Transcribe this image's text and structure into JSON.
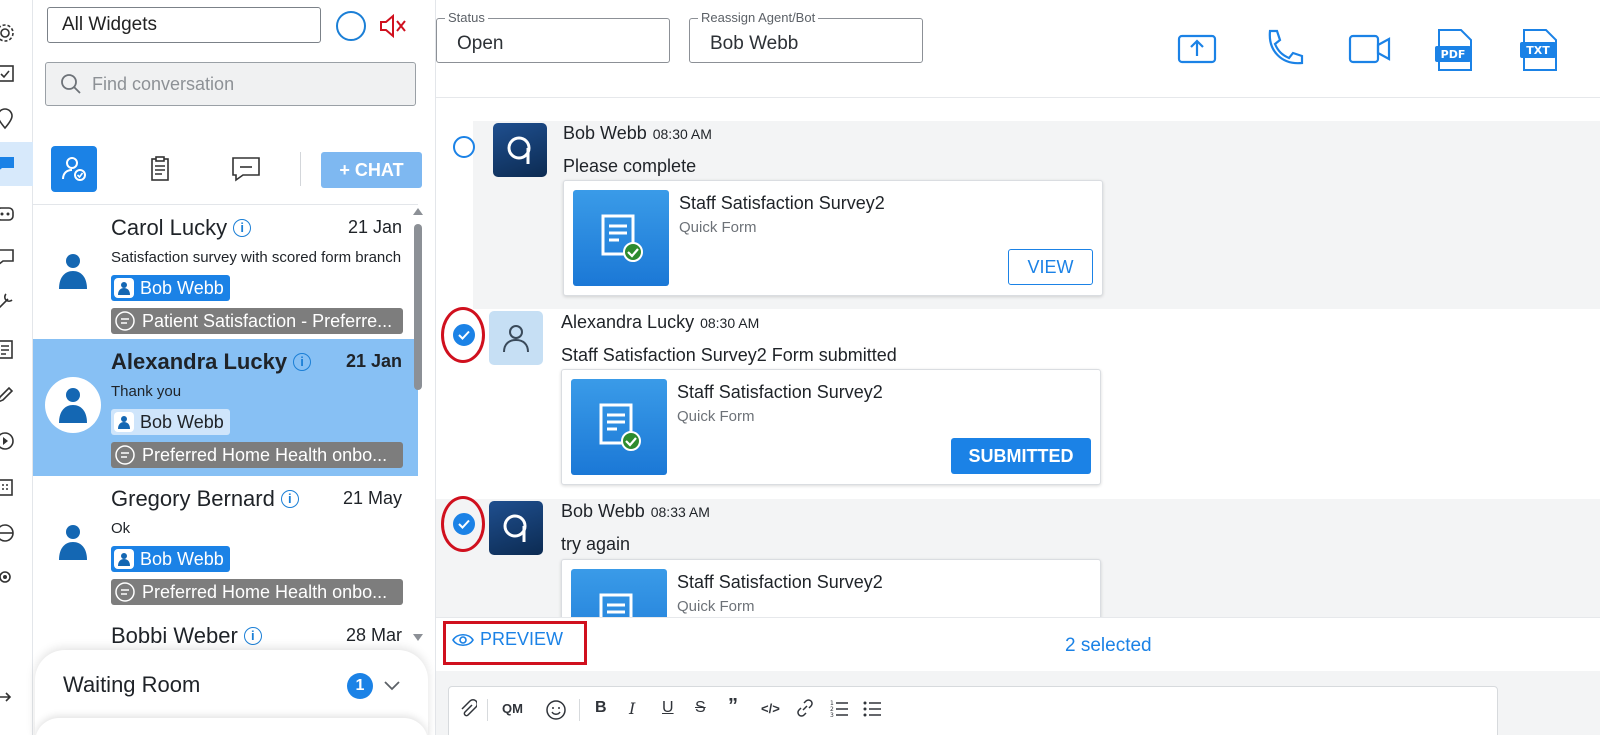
{
  "sidebar_rail": {
    "icons": [
      "settings-icon",
      "calendar-check-icon",
      "location-pin-icon",
      "chat-icon",
      "bot-icon",
      "comments-icon",
      "tools-icon",
      "forms-icon",
      "edit-icon",
      "play-circle-icon",
      "schedule-icon",
      "pie-chart-icon",
      "network-icon",
      "logout-icon"
    ],
    "active_index": 3
  },
  "conversations_panel": {
    "filter_value": "All Widgets",
    "search_placeholder": "Find conversation",
    "new_chat_label": "+ CHAT",
    "items": [
      {
        "name": "Carol Lucky",
        "date": "21 Jan",
        "preview": "Satisfaction survey with scored form branching",
        "agent": "Bob Webb",
        "form": "Patient Satisfaction - Preferre...",
        "selected": false
      },
      {
        "name": "Alexandra Lucky",
        "date": "21 Jan",
        "preview": "Thank you",
        "agent": "Bob Webb",
        "form": "Preferred Home Health onbo...",
        "selected": true
      },
      {
        "name": "Gregory Bernard",
        "date": "21 May",
        "preview": "Ok",
        "agent": "Bob Webb",
        "form": "Preferred Home Health onbo...",
        "selected": false
      },
      {
        "name": "Bobbi Weber",
        "date": "28 Mar",
        "preview": "",
        "agent": "",
        "form": "",
        "selected": false
      }
    ],
    "waiting_room": {
      "label": "Waiting Room",
      "count": "1"
    }
  },
  "header": {
    "status_legend": "Status",
    "status_value": "Open",
    "reassign_legend": "Reassign Agent/Bot",
    "reassign_value": "Bob Webb",
    "actions": [
      "upload-icon",
      "phone-icon",
      "video-icon",
      "pdf-export-icon",
      "txt-export-icon"
    ]
  },
  "messages": [
    {
      "sender": "Bob Webb",
      "time": "08:30 AM",
      "text": "Please complete",
      "card_title": "Staff Satisfaction Survey2",
      "card_subtitle": "Quick Form",
      "card_action": "VIEW",
      "checked": false
    },
    {
      "sender": "Alexandra Lucky",
      "time": "08:30 AM",
      "text": "Staff Satisfaction Survey2 Form submitted",
      "card_title": "Staff Satisfaction Survey2",
      "card_subtitle": "Quick Form",
      "card_action": "SUBMITTED",
      "checked": true
    },
    {
      "sender": "Bob Webb",
      "time": "08:33 AM",
      "text": "try again",
      "card_title": "Staff Satisfaction Survey2",
      "card_subtitle": "Quick Form",
      "card_action": "",
      "checked": true
    }
  ],
  "selection_bar": {
    "preview_label": "PREVIEW",
    "selected_count": "2 selected"
  },
  "composer_toolbar": {
    "qm_label": "QM",
    "tools": [
      "attach-icon",
      "quick-message-icon",
      "emoji-icon",
      "bold-icon",
      "italic-icon",
      "underline-icon",
      "strikethrough-icon",
      "quote-icon",
      "code-icon",
      "link-icon",
      "numbered-list-icon",
      "bullet-list-icon"
    ]
  },
  "colors": {
    "accent": "#1b82e6",
    "selected_row": "#87c0f4",
    "highlight": "#d0101e",
    "form_chip": "#7d7d7d"
  }
}
